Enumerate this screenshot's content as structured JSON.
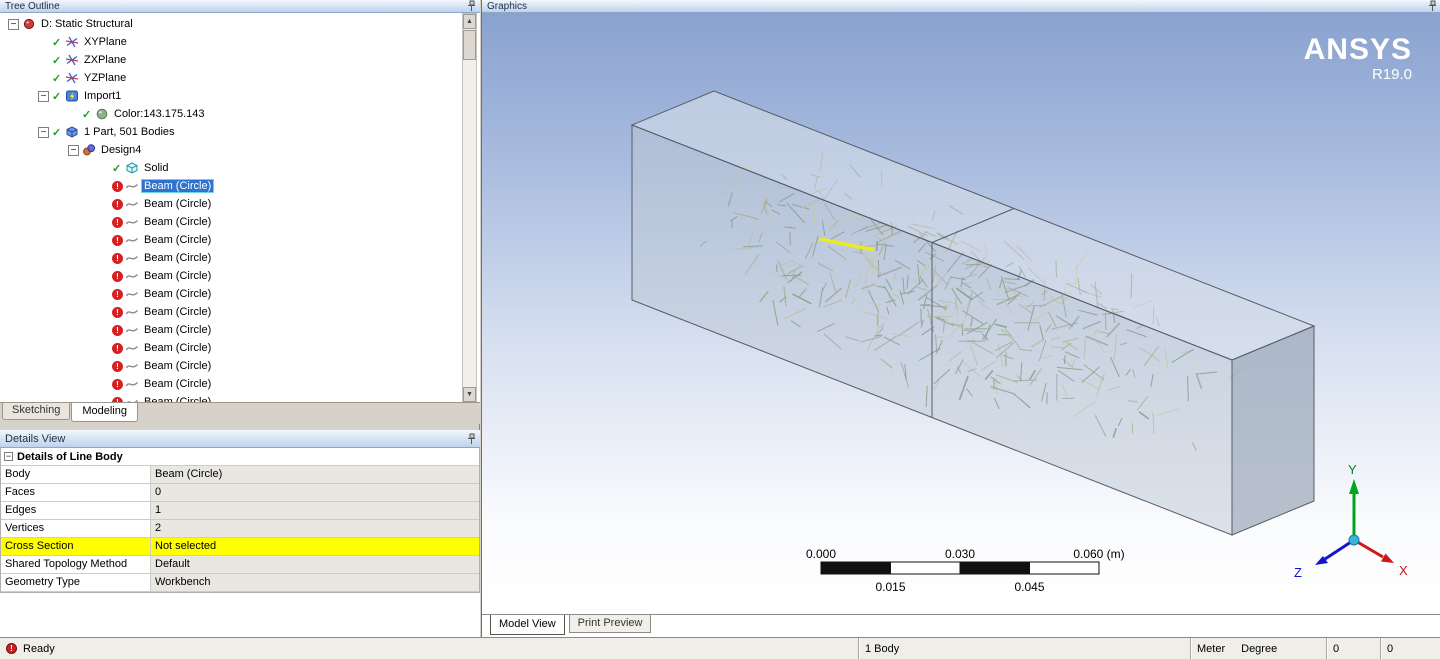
{
  "colors": {
    "selection_blue": "#2c74cf",
    "highlight_yellow": "#ffff00",
    "fiber_colors": [
      "#8f8f45",
      "#b9b97e",
      "#5d7c42",
      "#8a8a7a",
      "#c9c985",
      "#6f6f4e",
      "#4f7a52",
      "#9c9c5e"
    ]
  },
  "tree_panel": {
    "title": "Tree Outline",
    "tabs": [
      {
        "label": "Sketching",
        "active": false
      },
      {
        "label": "Modeling",
        "active": true
      }
    ],
    "items": [
      {
        "depth": 0,
        "expand": "-",
        "icon": "project",
        "label": "D: Static Structural"
      },
      {
        "depth": 1,
        "check": "✓",
        "icon": "plane",
        "label": "XYPlane"
      },
      {
        "depth": 1,
        "check": "✓",
        "icon": "plane",
        "label": "ZXPlane"
      },
      {
        "depth": 1,
        "check": "✓",
        "icon": "plane",
        "label": "YZPlane"
      },
      {
        "depth": 1,
        "expand": "-",
        "check": "✓",
        "icon": "import",
        "label": "Import1"
      },
      {
        "depth": 2,
        "check": "✓",
        "icon": "color",
        "label": "Color:143.175.143"
      },
      {
        "depth": 1,
        "expand": "-",
        "check": "✓",
        "icon": "part",
        "label": "1 Part, 501 Bodies"
      },
      {
        "depth": 2,
        "expand": "-",
        "icon": "design",
        "label": "Design4"
      },
      {
        "depth": 3,
        "check": "✓",
        "icon": "solid",
        "label": "Solid"
      },
      {
        "depth": 3,
        "error": true,
        "icon": "beam",
        "label": "Beam (Circle)",
        "selected": true
      },
      {
        "depth": 3,
        "error": true,
        "icon": "beam",
        "label": "Beam (Circle)"
      },
      {
        "depth": 3,
        "error": true,
        "icon": "beam",
        "label": "Beam (Circle)"
      },
      {
        "depth": 3,
        "error": true,
        "icon": "beam",
        "label": "Beam (Circle)"
      },
      {
        "depth": 3,
        "error": true,
        "icon": "beam",
        "label": "Beam (Circle)"
      },
      {
        "depth": 3,
        "error": true,
        "icon": "beam",
        "label": "Beam (Circle)"
      },
      {
        "depth": 3,
        "error": true,
        "icon": "beam",
        "label": "Beam (Circle)"
      },
      {
        "depth": 3,
        "error": true,
        "icon": "beam",
        "label": "Beam (Circle)"
      },
      {
        "depth": 3,
        "error": true,
        "icon": "beam",
        "label": "Beam (Circle)"
      },
      {
        "depth": 3,
        "error": true,
        "icon": "beam",
        "label": "Beam (Circle)"
      },
      {
        "depth": 3,
        "error": true,
        "icon": "beam",
        "label": "Beam (Circle)"
      },
      {
        "depth": 3,
        "error": true,
        "icon": "beam",
        "label": "Beam (Circle)"
      },
      {
        "depth": 3,
        "error": true,
        "icon": "beam",
        "label": "Beam (Circle)"
      }
    ]
  },
  "details_panel": {
    "title": "Details View",
    "header": "Details of Line Body",
    "rows": [
      {
        "label": "Body",
        "value": "Beam (Circle)"
      },
      {
        "label": "Faces",
        "value": "0"
      },
      {
        "label": "Edges",
        "value": "1"
      },
      {
        "label": "Vertices",
        "value": "2"
      },
      {
        "label": "Cross Section",
        "value": "Not selected",
        "highlight": true
      },
      {
        "label": "Shared Topology Method",
        "value": "Default"
      },
      {
        "label": "Geometry Type",
        "value": "Workbench"
      }
    ]
  },
  "graphics_panel": {
    "title": "Graphics",
    "brand": "ANSYS",
    "brand_version": "R19.0",
    "ruler": {
      "top_labels": [
        "0.000",
        "0.030",
        "0.060 (m)"
      ],
      "bottom_labels": [
        "0.015",
        "0.045"
      ]
    },
    "triad": {
      "x": "X",
      "y": "Y",
      "z": "Z"
    },
    "tabs": [
      {
        "label": "Model View",
        "active": true
      },
      {
        "label": "Print Preview",
        "active": false
      }
    ]
  },
  "status_bar": {
    "status": "Ready",
    "selection_info": "1 Body",
    "length_unit": "Meter",
    "angle_unit": "Degree",
    "counter1": "0",
    "counter2": "0"
  }
}
